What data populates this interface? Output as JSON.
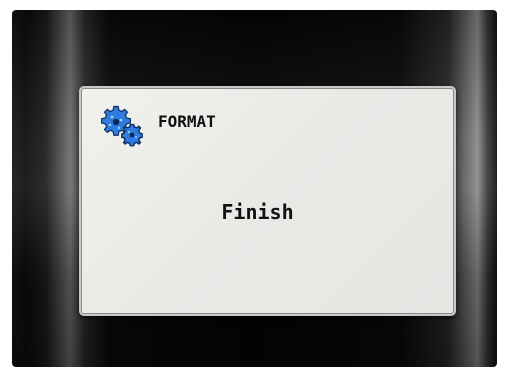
{
  "dialog": {
    "title": "FORMAT",
    "icon": "gear-icon",
    "message": "Finish"
  },
  "colors": {
    "icon_fill": "#2f7be0",
    "icon_outline": "#0b2a5c",
    "dialog_bg": "#ececea",
    "text": "#111111"
  }
}
